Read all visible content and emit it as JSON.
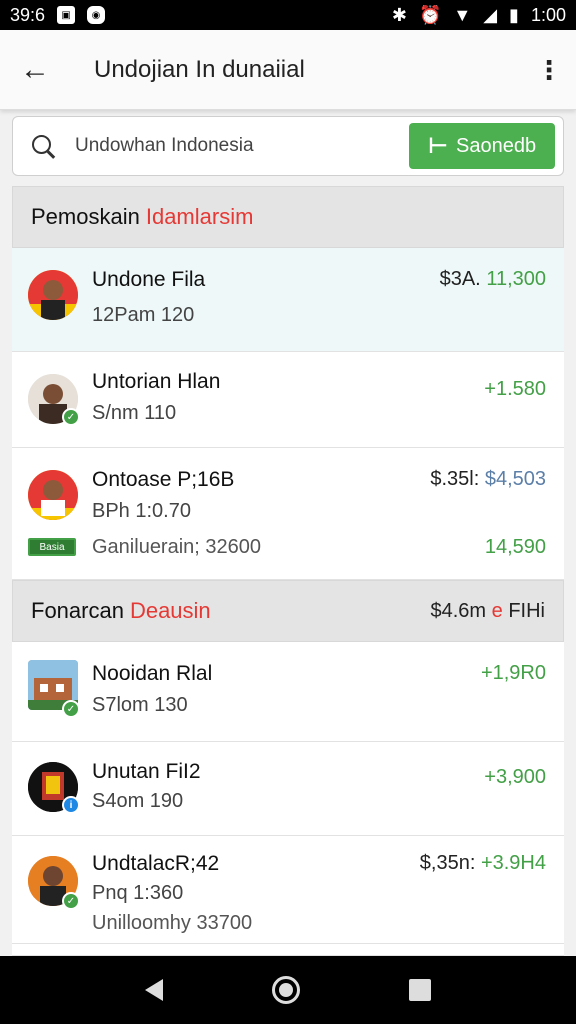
{
  "status_bar": {
    "time_left": "39:6",
    "time_right": "1:00"
  },
  "app_bar": {
    "title": "Undojian In dunaiial"
  },
  "search": {
    "value": "Undowhan Indonesia",
    "button_label": "Saonedb"
  },
  "sections": [
    {
      "title": "Pemoskain",
      "accent": "Idamlarsim",
      "items": [
        {
          "name": "Undone Fila",
          "sub": "12Pam 120",
          "amount_dark": "$3A.",
          "amount_green": "11,300",
          "highlighted": true
        },
        {
          "name": "Untorian Hlan",
          "sub": "S/​nm 110",
          "amount_green": "+1.580"
        },
        {
          "name": "Ontoase P;16B",
          "sub": "BPh 1:0.70",
          "amount_dark": "$.35l:",
          "amount_blue": "$4,503",
          "tag": "Basia",
          "sub2": "Ganiluerain; 32600",
          "amount2": "14,590"
        }
      ]
    },
    {
      "title": "Fonarcan",
      "accent": "Deausin",
      "right_dark": "$4.6m",
      "right_red": "e",
      "right_tail": "FIHi",
      "items": [
        {
          "name": "Nooidan Rlal",
          "sub": "S7lom 130",
          "amount_green": "+1,9R0"
        },
        {
          "name": "Unutan FiI2",
          "sub": "S4om 190",
          "amount_green": "+3,900"
        },
        {
          "name": "UndtalacR;42",
          "sub": "Pnq 1:360",
          "amount_dark": "$,35n:",
          "amount_green": "+3.9H4",
          "sub2": "Unilloomhy 33700"
        }
      ]
    }
  ],
  "colors": {
    "accent_green": "#4caf50",
    "accent_red": "#e53935",
    "amount_green": "#43a047"
  }
}
